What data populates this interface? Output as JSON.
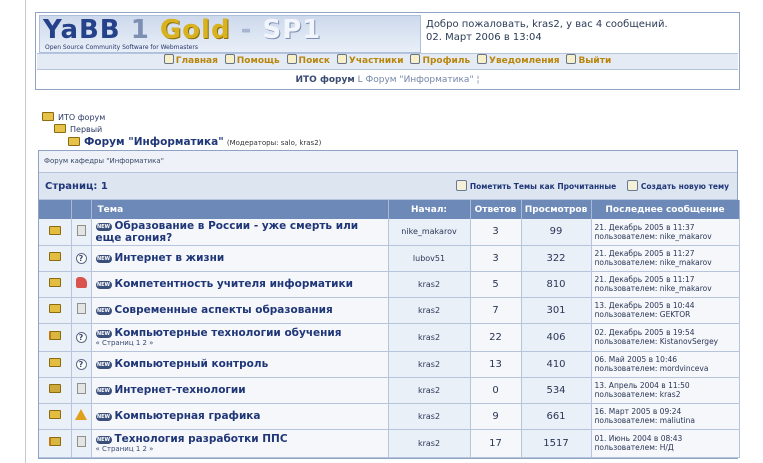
{
  "header": {
    "logo_yabb": "YaBB",
    "logo_one": "1",
    "logo_gold": "Gold",
    "logo_dash": "-",
    "logo_sp": "SP1",
    "logo_subtitle": "Open Source Community Software for Webmasters",
    "welcome_line1": "Добро пожаловать, kras2, у вас 4 сообщений.",
    "welcome_line2": "02. Март 2006 в 13:04"
  },
  "menu": [
    {
      "label": "Главная",
      "icon": "home-icon"
    },
    {
      "label": "Помощь",
      "icon": "help-icon"
    },
    {
      "label": "Поиск",
      "icon": "search-icon"
    },
    {
      "label": "Участники",
      "icon": "members-icon"
    },
    {
      "label": "Профиль",
      "icon": "profile-icon"
    },
    {
      "label": "Уведомления",
      "icon": "notifications-icon"
    },
    {
      "label": "Выйти",
      "icon": "logout-icon"
    }
  ],
  "linktree": {
    "root": "ИТО форум",
    "sep": "L",
    "current": "Форум \"Информатика\"",
    "tail": "¦"
  },
  "tree": {
    "root": "ИТО форум",
    "category": "Первый",
    "forum": "Форум \"Информатика\"",
    "moderators": "(Модераторы: salo, kras2)"
  },
  "board": {
    "description": "Форум кафедры \"Информатика\"",
    "pages_label": "Страниц: 1",
    "mark_read": "Пометить Темы как Прочитанные",
    "new_topic": "Создать новую тему",
    "columns": [
      "Тема",
      "Начал:",
      "Ответов",
      "Просмотров",
      "Последнее сообщение"
    ]
  },
  "topics": [
    {
      "title": "Образование в России - уже смерть или еще агония?",
      "starter": "nike_makarov",
      "replies": "3",
      "views": "99",
      "last_date": "21. Декабрь 2005 в 11:37",
      "last_user": "пользователем: nike_makarov",
      "subpages": "",
      "folder": "normal",
      "status": "doc"
    },
    {
      "title": "Интернет в жизни",
      "starter": "lubov51",
      "replies": "3",
      "views": "322",
      "last_date": "21. Декабрь 2005 в 11:27",
      "last_user": "пользователем: nike_makarov",
      "subpages": "",
      "folder": "normal",
      "status": "question"
    },
    {
      "title": "Компетентность учителя информатики",
      "starter": "kras2",
      "replies": "5",
      "views": "810",
      "last_date": "21. Декабрь 2005 в 11:17",
      "last_user": "пользователем: nike_makarov",
      "subpages": "",
      "folder": "normal",
      "status": "thumb"
    },
    {
      "title": "Современные аспекты образования",
      "starter": "kras2",
      "replies": "7",
      "views": "301",
      "last_date": "13. Декабрь 2005 в 10:44",
      "last_user": "пользователем: GEKTOR",
      "subpages": "",
      "folder": "normal",
      "status": "doc"
    },
    {
      "title": "Компьютерные технологии обучения",
      "starter": "kras2",
      "replies": "22",
      "views": "406",
      "last_date": "02. Декабрь 2005 в 19:54",
      "last_user": "пользователем: KistanovSergey",
      "subpages": "« Страниц 1 2 »",
      "folder": "flag",
      "status": "question"
    },
    {
      "title": "Компьютерный контроль",
      "starter": "kras2",
      "replies": "13",
      "views": "410",
      "last_date": "06. Май 2005 в 10:46",
      "last_user": "пользователем: mordvinceva",
      "subpages": "",
      "folder": "normal",
      "status": "question"
    },
    {
      "title": "Интернет-технологии",
      "starter": "kras2",
      "replies": "0",
      "views": "534",
      "last_date": "13. Апрель 2004 в 11:50",
      "last_user": "пользователем: kras2",
      "subpages": "",
      "folder": "lock",
      "status": "doc"
    },
    {
      "title": "Компьютерная графика",
      "starter": "kras2",
      "replies": "9",
      "views": "661",
      "last_date": "16. Март 2005 в 09:24",
      "last_user": "пользователем: maliutina",
      "subpages": "",
      "folder": "normal",
      "status": "warning"
    },
    {
      "title": "Технология разработки ППС",
      "starter": "kras2",
      "replies": "17",
      "views": "1517",
      "last_date": "01. Июнь 2004 в 08:43",
      "last_user": "пользователем: Н/Д",
      "subpages": "« Страниц 1 2 »",
      "folder": "flag",
      "status": "doc"
    }
  ],
  "new_badge": "NEW",
  "colors": {
    "header_bg": "#6d89b8",
    "link": "#1f3677",
    "menu": "#b8860b"
  }
}
